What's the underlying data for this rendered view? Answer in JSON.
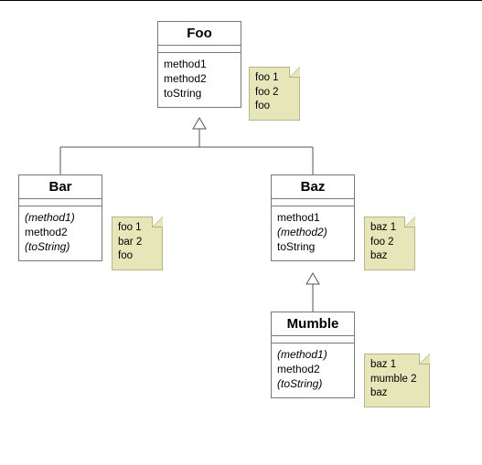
{
  "classes": {
    "foo": {
      "name": "Foo",
      "methods": [
        {
          "text": "method1",
          "italic": false
        },
        {
          "text": "method2",
          "italic": false
        },
        {
          "text": "toString",
          "italic": false
        }
      ]
    },
    "bar": {
      "name": "Bar",
      "methods": [
        {
          "text": "(method1)",
          "italic": true
        },
        {
          "text": "method2",
          "italic": false
        },
        {
          "text": "(toString)",
          "italic": true
        }
      ]
    },
    "baz": {
      "name": "Baz",
      "methods": [
        {
          "text": "method1",
          "italic": false
        },
        {
          "text": "(method2)",
          "italic": true
        },
        {
          "text": "toString",
          "italic": false
        }
      ]
    },
    "mumble": {
      "name": "Mumble",
      "methods": [
        {
          "text": "(method1)",
          "italic": true
        },
        {
          "text": "method2",
          "italic": false
        },
        {
          "text": "(toString)",
          "italic": true
        }
      ]
    }
  },
  "notes": {
    "foo": {
      "lines": [
        "foo 1",
        "foo 2",
        "foo"
      ]
    },
    "bar": {
      "lines": [
        "foo 1",
        "bar 2",
        "foo"
      ]
    },
    "baz": {
      "lines": [
        "baz 1",
        "foo 2",
        "baz"
      ]
    },
    "mumble": {
      "lines": [
        "baz 1",
        "mumble 2",
        "baz"
      ]
    }
  },
  "chart_data": {
    "type": "uml-class-diagram",
    "classes": [
      {
        "id": "Foo",
        "methods": [
          "method1",
          "method2",
          "toString"
        ],
        "note": [
          "foo 1",
          "foo 2",
          "foo"
        ]
      },
      {
        "id": "Bar",
        "methods": [
          "(method1)",
          "method2",
          "(toString)"
        ],
        "note": [
          "foo 1",
          "bar 2",
          "foo"
        ]
      },
      {
        "id": "Baz",
        "methods": [
          "method1",
          "(method2)",
          "toString"
        ],
        "note": [
          "baz 1",
          "foo 2",
          "baz"
        ]
      },
      {
        "id": "Mumble",
        "methods": [
          "(method1)",
          "method2",
          "(toString)"
        ],
        "note": [
          "baz 1",
          "mumble 2",
          "baz"
        ]
      }
    ],
    "inheritance": [
      {
        "child": "Bar",
        "parent": "Foo"
      },
      {
        "child": "Baz",
        "parent": "Foo"
      },
      {
        "child": "Mumble",
        "parent": "Baz"
      }
    ]
  }
}
